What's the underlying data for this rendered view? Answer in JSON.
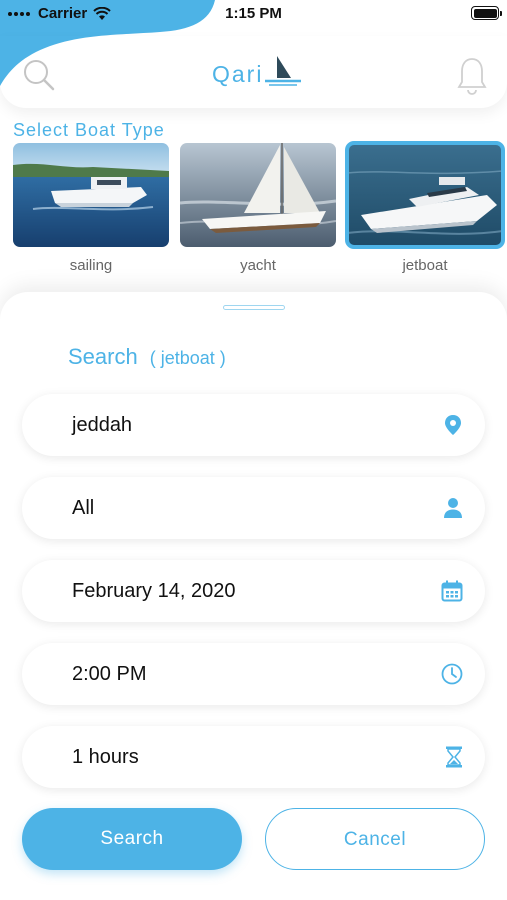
{
  "status_bar": {
    "carrier": "Carrier",
    "time": "1:15 PM"
  },
  "header": {
    "logo_text": "Qari"
  },
  "boat_section": {
    "label": "Select Boat Type",
    "boats": [
      {
        "name": "sailing",
        "selected": false
      },
      {
        "name": "yacht",
        "selected": false
      },
      {
        "name": "jetboat",
        "selected": true
      }
    ]
  },
  "search_panel": {
    "title": "Search",
    "selected_type": "( jetboat )",
    "fields": {
      "location": "jeddah",
      "guests": "All",
      "date": "February 14, 2020",
      "time": "2:00 PM",
      "duration": "1 hours"
    },
    "search_label": "Search",
    "cancel_label": "Cancel"
  },
  "colors": {
    "accent": "#4db3e6"
  },
  "icons": [
    "wifi-icon",
    "battery-icon",
    "search-icon",
    "sail-logo-icon",
    "bell-icon",
    "location-pin-icon",
    "user-icon",
    "calendar-icon",
    "clock-icon",
    "hourglass-icon"
  ]
}
